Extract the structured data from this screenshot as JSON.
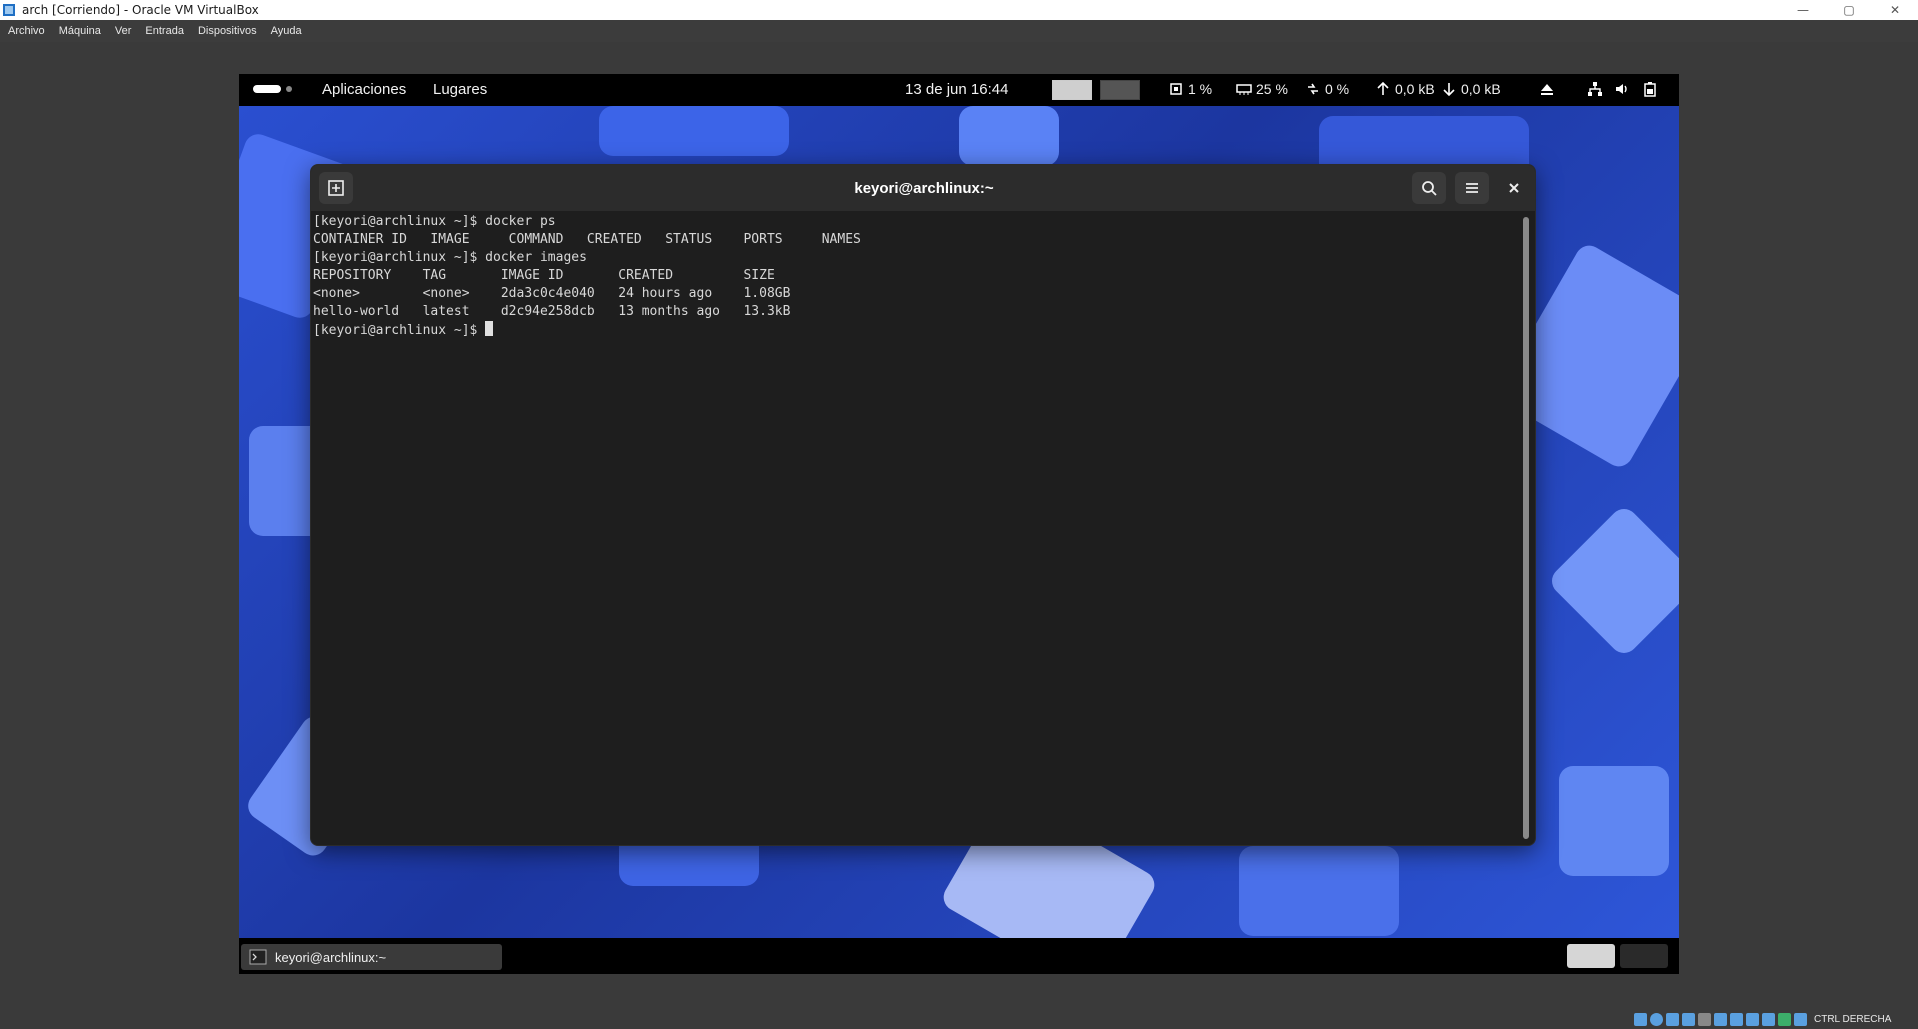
{
  "host_window": {
    "title": "arch [Corriendo] - Oracle VM VirtualBox",
    "minimize_label": "—",
    "maximize_label": "▢",
    "close_label": "✕"
  },
  "host_menu": [
    "Archivo",
    "Máquina",
    "Ver",
    "Entrada",
    "Dispositivos",
    "Ayuda"
  ],
  "gnome_topbar": {
    "apps_menu": "Aplicaciones",
    "places_menu": "Lugares",
    "clock": "13 de jun  16:44",
    "cpu": "1 %",
    "memory": "25 %",
    "swap": "0 %",
    "net_up": "0,0 kB",
    "net_down": "0,0 kB"
  },
  "terminal": {
    "title": "keyori@archlinux:~",
    "lines": [
      "[keyori@archlinux ~]$ docker ps",
      "CONTAINER ID   IMAGE     COMMAND   CREATED   STATUS    PORTS     NAMES",
      "[keyori@archlinux ~]$ docker images",
      "REPOSITORY    TAG       IMAGE ID       CREATED         SIZE",
      "<none>        <none>    2da3c0c4e040   24 hours ago    1.08GB",
      "hello-world   latest    d2c94e258dcb   13 months ago   13.3kB"
    ],
    "prompt": "[keyori@archlinux ~]$ "
  },
  "taskbar": {
    "window_label": "keyori@archlinux:~"
  },
  "host_status": {
    "host_key": "CTRL DERECHA"
  },
  "colors": {
    "accent_wallpaper": "#2a4fd0",
    "terminal_bg": "#1e1e1e",
    "header_bg": "#2c2c2c"
  }
}
